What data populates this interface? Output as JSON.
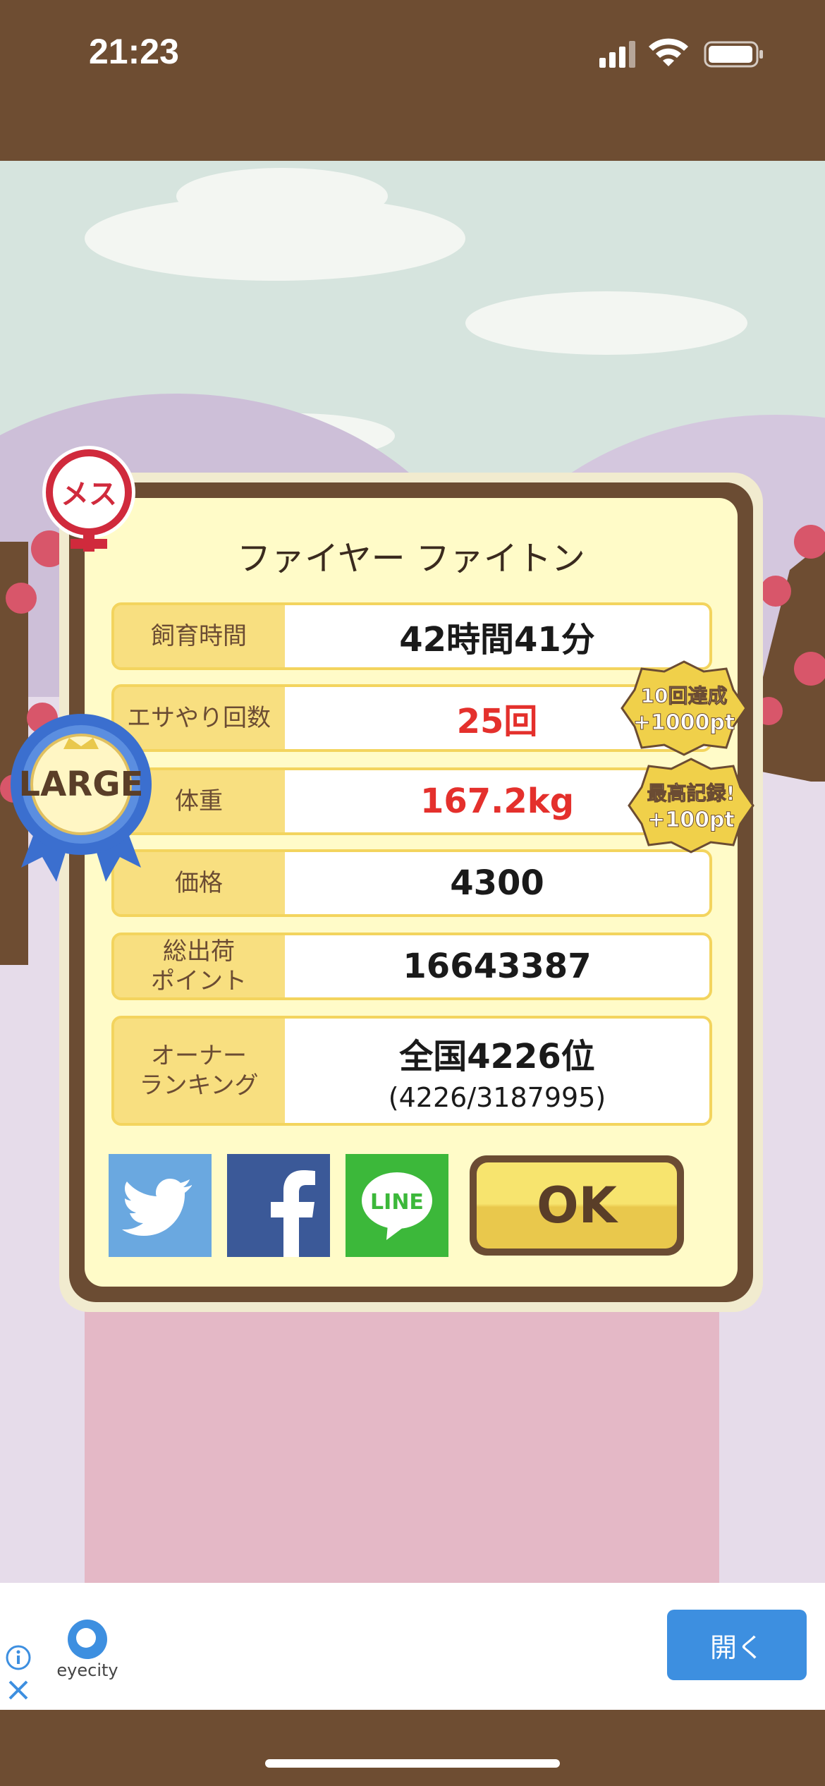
{
  "status": {
    "time": "21:23"
  },
  "result": {
    "gender_badge": "メス",
    "size_badge": "LARGE",
    "name": "ファイヤー ファイトン",
    "stats": [
      {
        "label": "飼育時間",
        "value": "42時間41分",
        "highlight": false
      },
      {
        "label": "エサやり回数",
        "value": "25回",
        "highlight": true
      },
      {
        "label": "体重",
        "value": "167.2kg",
        "highlight": true
      },
      {
        "label": "価格",
        "value": "4300",
        "highlight": false
      },
      {
        "label": "総出荷\nポイント",
        "value": "16643387",
        "highlight": false
      },
      {
        "label": "オーナー\nランキング",
        "value": "全国4226位",
        "sub": "(4226/3187995)",
        "highlight": false
      }
    ],
    "bonus_badges": [
      {
        "line1": "10回達成",
        "line2": "+1000pt"
      },
      {
        "line1": "最高記録!",
        "line2": "+100pt"
      }
    ],
    "share": {
      "twitter": "twitter-icon",
      "facebook": "facebook-icon",
      "line": "LINE"
    },
    "ok_label": "OK"
  },
  "ad": {
    "brand": "eyecity",
    "open_label": "開く"
  },
  "colors": {
    "brown": "#6b4c33",
    "panel_bg": "#fffbc8",
    "label_bg": "#f8df80",
    "highlight_red": "#e4302c",
    "twitter": "#6aa8e0",
    "facebook": "#3b5998",
    "line": "#3cb83a",
    "ad_button": "#3d8fe0"
  }
}
